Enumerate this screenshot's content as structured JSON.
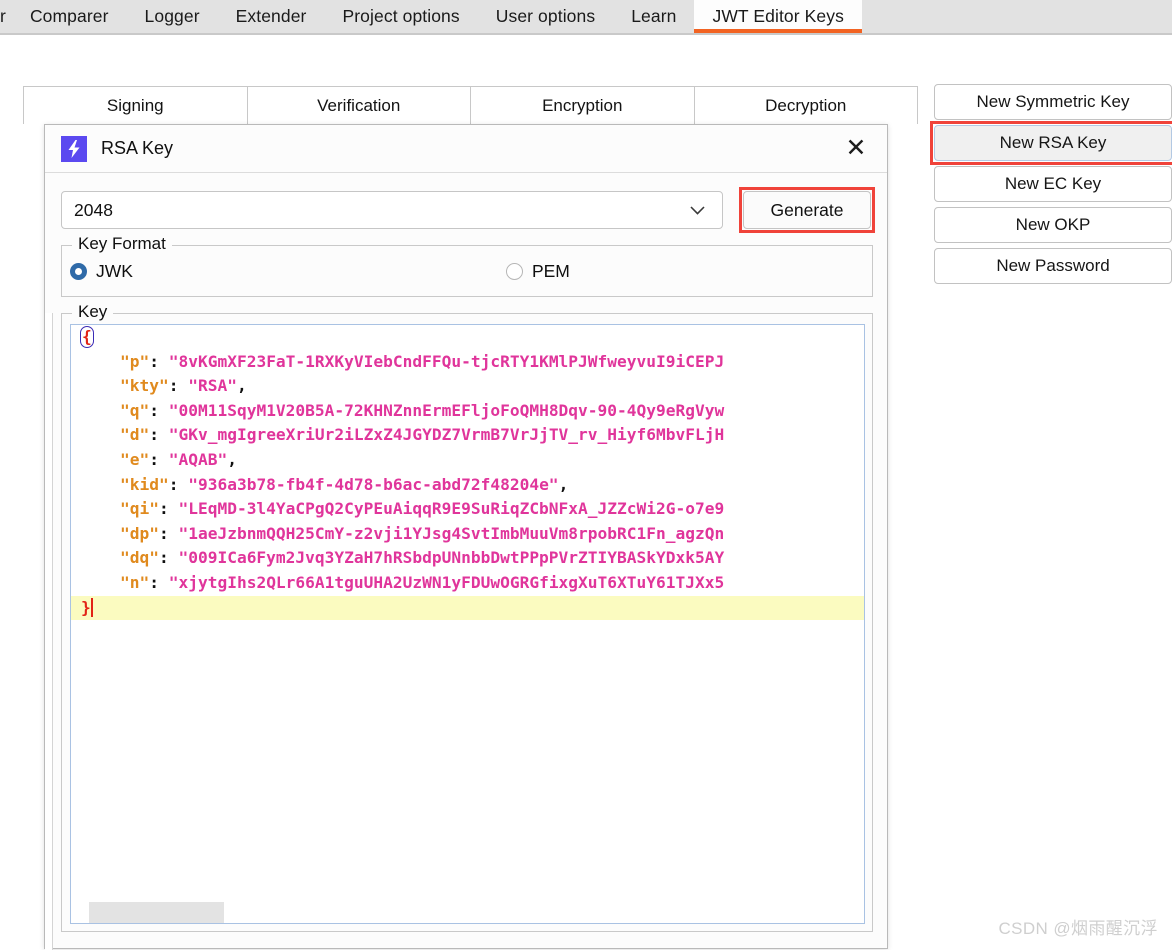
{
  "main_tabs": [
    {
      "label": "r",
      "active": false,
      "partial": true
    },
    {
      "label": "Comparer",
      "active": false
    },
    {
      "label": "Logger",
      "active": false
    },
    {
      "label": "Extender",
      "active": false
    },
    {
      "label": "Project options",
      "active": false
    },
    {
      "label": "User options",
      "active": false
    },
    {
      "label": "Learn",
      "active": false
    },
    {
      "label": "JWT Editor Keys",
      "active": true
    }
  ],
  "sub_tabs": [
    {
      "label": "Signing"
    },
    {
      "label": "Verification"
    },
    {
      "label": "Encryption"
    },
    {
      "label": "Decryption"
    }
  ],
  "key_actions": [
    {
      "label": "New Symmetric Key",
      "focused": false,
      "highlighted": false
    },
    {
      "label": "New RSA Key",
      "focused": true,
      "highlighted": true
    },
    {
      "label": "New EC Key",
      "focused": false,
      "highlighted": false
    },
    {
      "label": "New OKP",
      "focused": false,
      "highlighted": false
    },
    {
      "label": "New Password",
      "focused": false,
      "highlighted": false
    }
  ],
  "dialog": {
    "title": "RSA Key",
    "icon": "lightning-bolt-icon",
    "close_label": "✕",
    "size": {
      "selected": "2048",
      "chevron": "∨"
    },
    "generate_label": "Generate",
    "generate_highlighted": true,
    "key_format": {
      "legend": "Key Format",
      "options": [
        {
          "label": "JWK",
          "selected": true
        },
        {
          "label": "PEM",
          "selected": false
        }
      ]
    },
    "key_section": {
      "legend": "Key",
      "lines": [
        {
          "indent": 0,
          "brace_open": "{"
        },
        {
          "indent": 1,
          "key": "\"p\"",
          "punc": ": ",
          "value": "\"8vKGmXF23FaT-1RXKyVIebCndFFQu-tjcRTY1KMlPJWfweyvuI9iCEPJ"
        },
        {
          "indent": 1,
          "key": "\"kty\"",
          "punc": ": ",
          "value": "\"RSA\"",
          "trail": ","
        },
        {
          "indent": 1,
          "key": "\"q\"",
          "punc": ": ",
          "value": "\"00M11SqyM1V20B5A-72KHNZnnErmEFljoFoQMH8Dqv-90-4Qy9eRgVyw"
        },
        {
          "indent": 1,
          "key": "\"d\"",
          "punc": ": ",
          "value": "\"GKv_mgIgreeXriUr2iLZxZ4JGYDZ7VrmB7VrJjTV_rv_Hiyf6MbvFLjH"
        },
        {
          "indent": 1,
          "key": "\"e\"",
          "punc": ": ",
          "value": "\"AQAB\"",
          "trail": ","
        },
        {
          "indent": 1,
          "key": "\"kid\"",
          "punc": ": ",
          "value": "\"936a3b78-fb4f-4d78-b6ac-abd72f48204e\"",
          "trail": ","
        },
        {
          "indent": 1,
          "key": "\"qi\"",
          "punc": ": ",
          "value": "\"LEqMD-3l4YaCPgQ2CyPEuAiqqR9E9SuRiqZCbNFxA_JZZcWi2G-o7e9"
        },
        {
          "indent": 1,
          "key": "\"dp\"",
          "punc": ": ",
          "value": "\"1aeJzbnmQQH25CmY-z2vji1YJsg4SvtImbMuuVm8rpobRC1Fn_agzQn"
        },
        {
          "indent": 1,
          "key": "\"dq\"",
          "punc": ": ",
          "value": "\"009ICa6Fym2Jvq3YZaH7hRSbdpUNnbbDwtPPpPVrZTIYBASkYDxk5AY"
        },
        {
          "indent": 1,
          "key": "\"n\"",
          "punc": ": ",
          "value": "\"xjytgIhs2QLr66A1tguUHA2UzWN1yFDUwOGRGfixgXuT6XTuY61TJXx5"
        },
        {
          "indent": 0,
          "brace_close": "}",
          "current": true
        }
      ]
    }
  },
  "watermark": "CSDN @烟雨醒沉浮",
  "colors": {
    "accent_orange": "#f26322",
    "highlight_red": "#f0433a",
    "dialog_icon_purple": "#5b49f0",
    "json_key": "#e08a1e",
    "json_string": "#e0359b",
    "json_brace": "#e22316",
    "radio_selected": "#2f6aa8",
    "current_line": "#fbfbc0"
  }
}
